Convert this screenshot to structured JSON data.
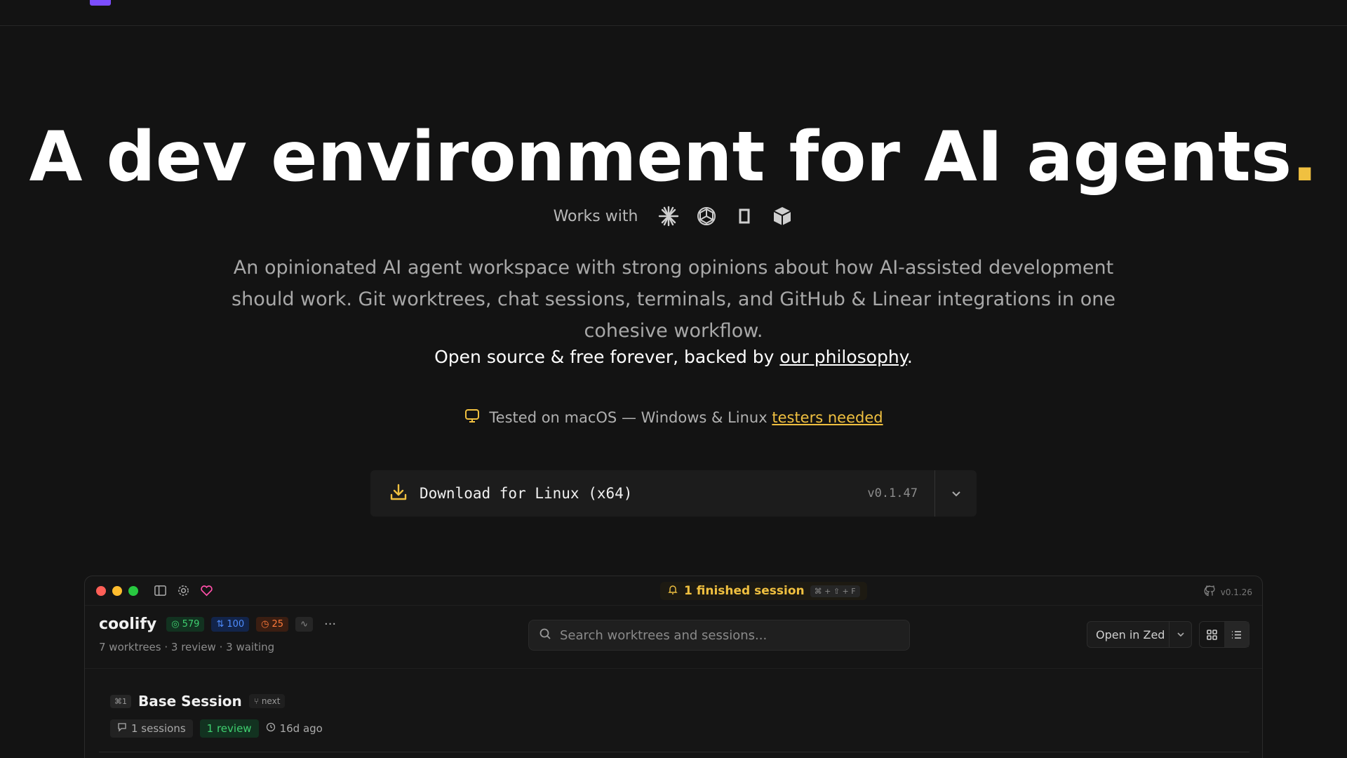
{
  "hero": {
    "title": "A dev environment for AI agents",
    "title_dot": ".",
    "works_with": "Works with",
    "agent_icons": [
      "claude-icon",
      "openai-icon",
      "opencode-icon",
      "cube-icon"
    ],
    "description": "An opinionated AI agent workspace with strong opinions about how AI-assisted development should work. Git worktrees, chat sessions, terminals, and GitHub & Linear integrations in one cohesive workflow.",
    "oss_prefix": "Open source & free forever, backed by ",
    "oss_link": "our philosophy",
    "oss_suffix": ".",
    "tested_text": "Tested on macOS — Windows & Linux ",
    "tested_link": "testers needed",
    "accent": "#f0c040"
  },
  "download": {
    "label": "Download for Linux (x64)",
    "version": "v0.1.47"
  },
  "app": {
    "finished_label": "1 finished session",
    "finished_kbd": "⌘ + ⇧ + F",
    "app_version": "v0.1.26",
    "project": {
      "name": "coolify",
      "issues": "579",
      "prs": "100",
      "alerts": "25",
      "subtitle": "7 worktrees · 3 review · 3 waiting"
    },
    "search_placeholder": "Search worktrees and sessions...",
    "open_in": "Open in Zed",
    "session": {
      "shortcut": "⌘1",
      "name": "Base Session",
      "branch": "next",
      "sessions": "1 sessions",
      "review": "1 review",
      "time": "16d ago"
    }
  }
}
